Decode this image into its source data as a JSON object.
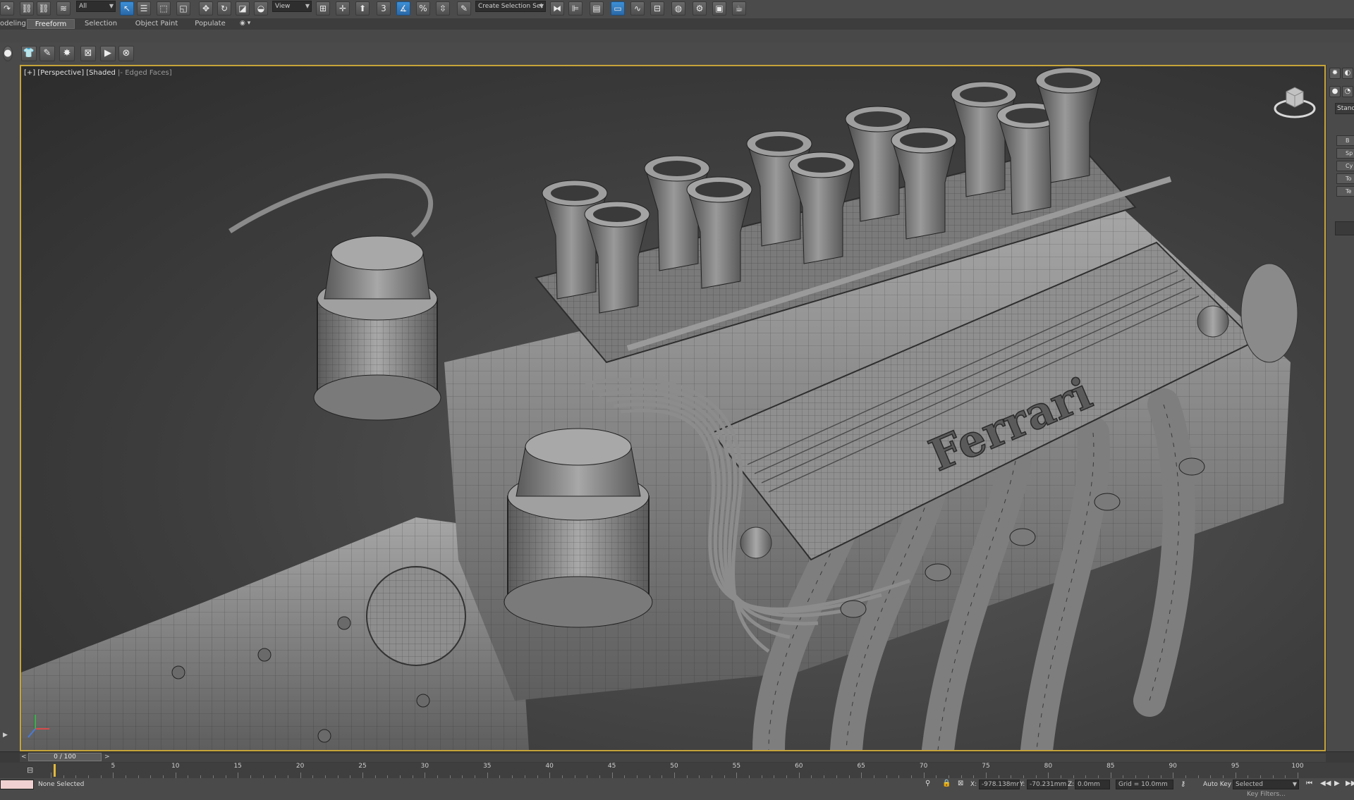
{
  "toolbar": {
    "selection_filter": "All",
    "reference_coord": "View",
    "named_selection_placeholder": "Create Selection Set"
  },
  "ribbon": {
    "tabs": [
      {
        "label": "odeling",
        "active": false
      },
      {
        "label": "Freeform",
        "active": true
      },
      {
        "label": "Selection",
        "active": false
      },
      {
        "label": "Object Paint",
        "active": false
      },
      {
        "label": "Populate",
        "active": false
      }
    ]
  },
  "viewport": {
    "label_plus": "[+]",
    "label_view": "[Perspective]",
    "label_shading": "[Shaded",
    "label_edges": "Edged Faces]",
    "engine_logo": "Ferrari"
  },
  "right_panel": {
    "dropdown": "Standa",
    "buttons": [
      "B",
      "Sp",
      "Cy",
      "To",
      "Te"
    ]
  },
  "timeline": {
    "frame_display": "0 / 100",
    "ticks": [
      "5",
      "10",
      "15",
      "20",
      "25",
      "30",
      "35",
      "40",
      "45",
      "50",
      "55",
      "60",
      "65",
      "70",
      "75",
      "80",
      "85",
      "90",
      "95",
      "100"
    ]
  },
  "status": {
    "selection_text": "None Selected",
    "x_label": "X:",
    "x_value": "-978.138mm",
    "y_label": "Y:",
    "y_value": "-70.231mm",
    "z_label": "Z:",
    "z_value": "0.0mm",
    "grid": "Grid = 10.0mm",
    "auto_key": "Auto Key",
    "key_mode": "Selected",
    "key_filters": "Key Filters..."
  },
  "colors": {
    "viewport_border": "#c6a43a",
    "active_tool": "#3d8fd6",
    "frame_marker": "#e2b93b"
  }
}
